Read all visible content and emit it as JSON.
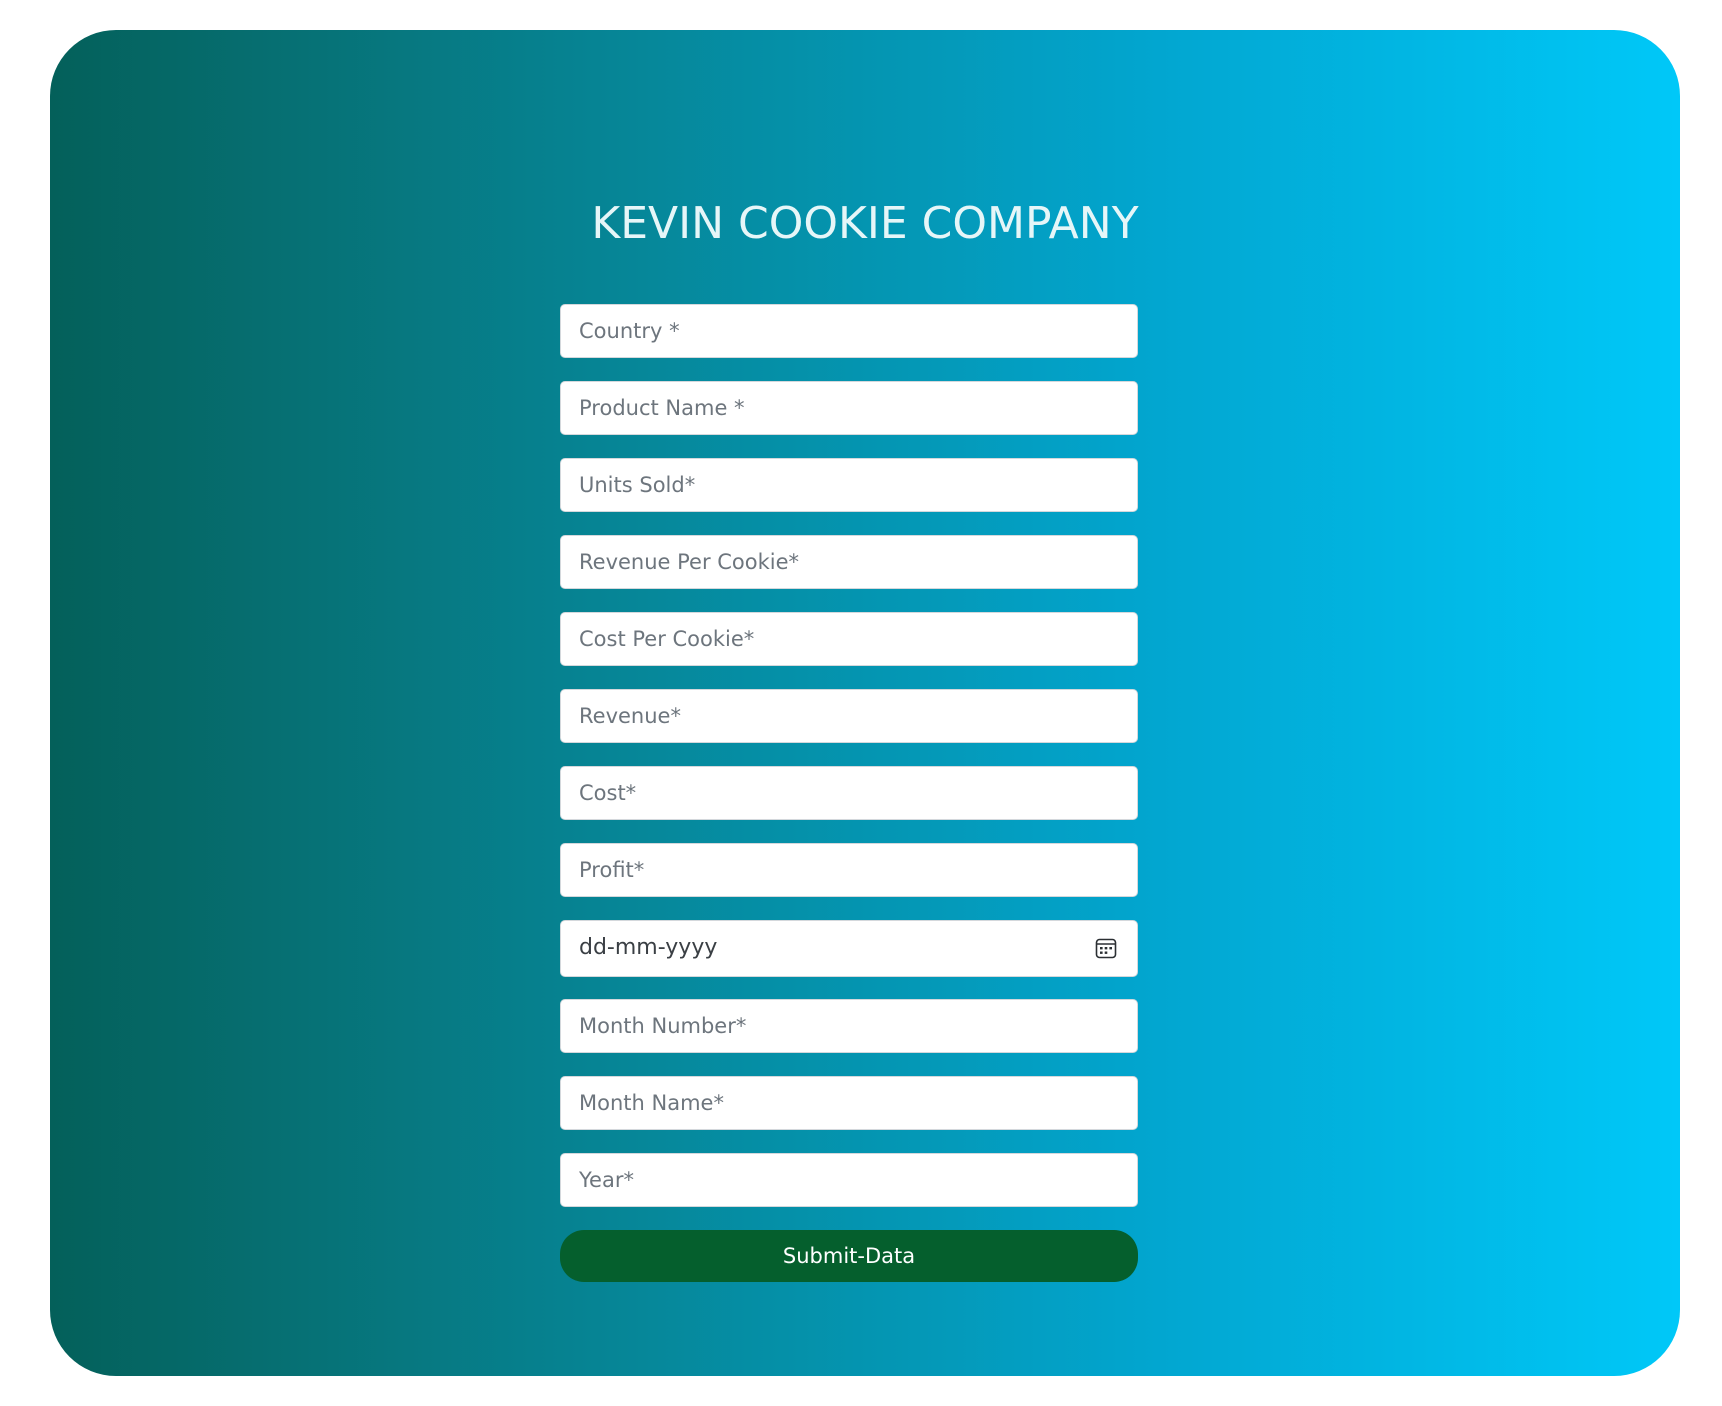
{
  "page": {
    "title": "KEVIN COOKIE COMPANY",
    "colors": {
      "gradient_start": "#04605a",
      "gradient_end": "#00c8f8",
      "submit_button": "#055f2d",
      "title_text": "#e6f6f8"
    }
  },
  "form": {
    "fields": {
      "country": {
        "placeholder": "Country *"
      },
      "product_name": {
        "placeholder": "Product Name *"
      },
      "units_sold": {
        "placeholder": "Units Sold*"
      },
      "revenue_per_cookie": {
        "placeholder": "Revenue Per Cookie*"
      },
      "cost_per_cookie": {
        "placeholder": "Cost Per Cookie*"
      },
      "revenue": {
        "placeholder": "Revenue*"
      },
      "cost": {
        "placeholder": "Cost*"
      },
      "profit": {
        "placeholder": "Profit*"
      },
      "date": {
        "placeholder": "dd-mm-yyyy",
        "icon": "calendar-icon"
      },
      "month_number": {
        "placeholder": "Month Number*"
      },
      "month_name": {
        "placeholder": "Month Name*"
      },
      "year": {
        "placeholder": "Year*"
      }
    },
    "submit_label": "Submit-Data"
  }
}
